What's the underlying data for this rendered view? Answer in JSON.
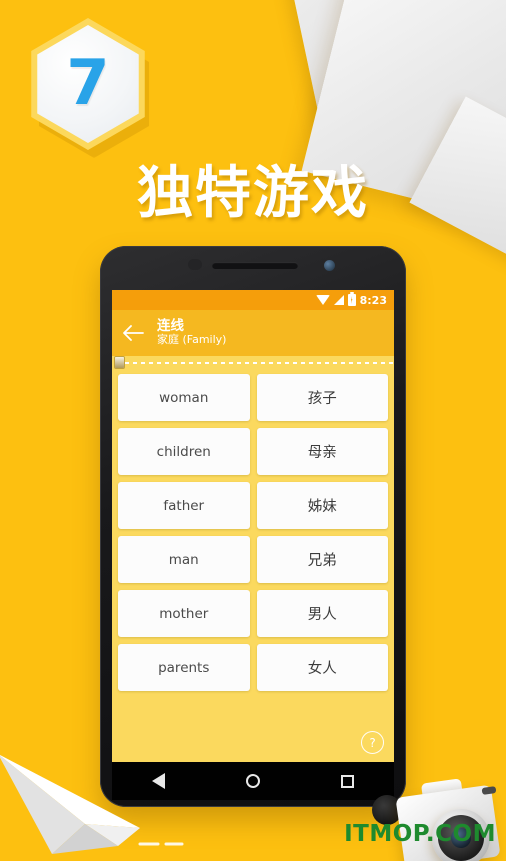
{
  "promo": {
    "badge_number": "7",
    "headline": "独特游戏",
    "background_color": "#FDC010",
    "headline_color": "#FFFFFF",
    "badge_number_color": "#29A3E8"
  },
  "watermark": {
    "text": "ITMOP.COM",
    "color": "#1E8A2E"
  },
  "phone": {
    "statusbar": {
      "time": "8:23",
      "wifi_icon": "wifi-icon",
      "signal_icon": "signal-icon",
      "battery_icon": "battery-charging-icon",
      "background_color": "#F59E0B"
    },
    "appbar": {
      "back_icon": "back-arrow-icon",
      "title": "连线",
      "subtitle": "家庭 (Family)",
      "background_color": "#F5B820"
    },
    "progress": {
      "marker_icon": "progress-marker-icon",
      "line_style": "dotted"
    },
    "game": {
      "background_color": "#FBD95E",
      "cards": [
        {
          "left": "woman",
          "right": "孩子"
        },
        {
          "left": "children",
          "right": "母亲"
        },
        {
          "left": "father",
          "right": "姊妹"
        },
        {
          "left": "man",
          "right": "兄弟"
        },
        {
          "left": "mother",
          "right": "男人"
        },
        {
          "left": "parents",
          "right": "女人"
        }
      ],
      "help_label": "?"
    },
    "navbar": {
      "back": "nav-back-icon",
      "home": "nav-home-icon",
      "recents": "nav-recents-icon"
    }
  }
}
